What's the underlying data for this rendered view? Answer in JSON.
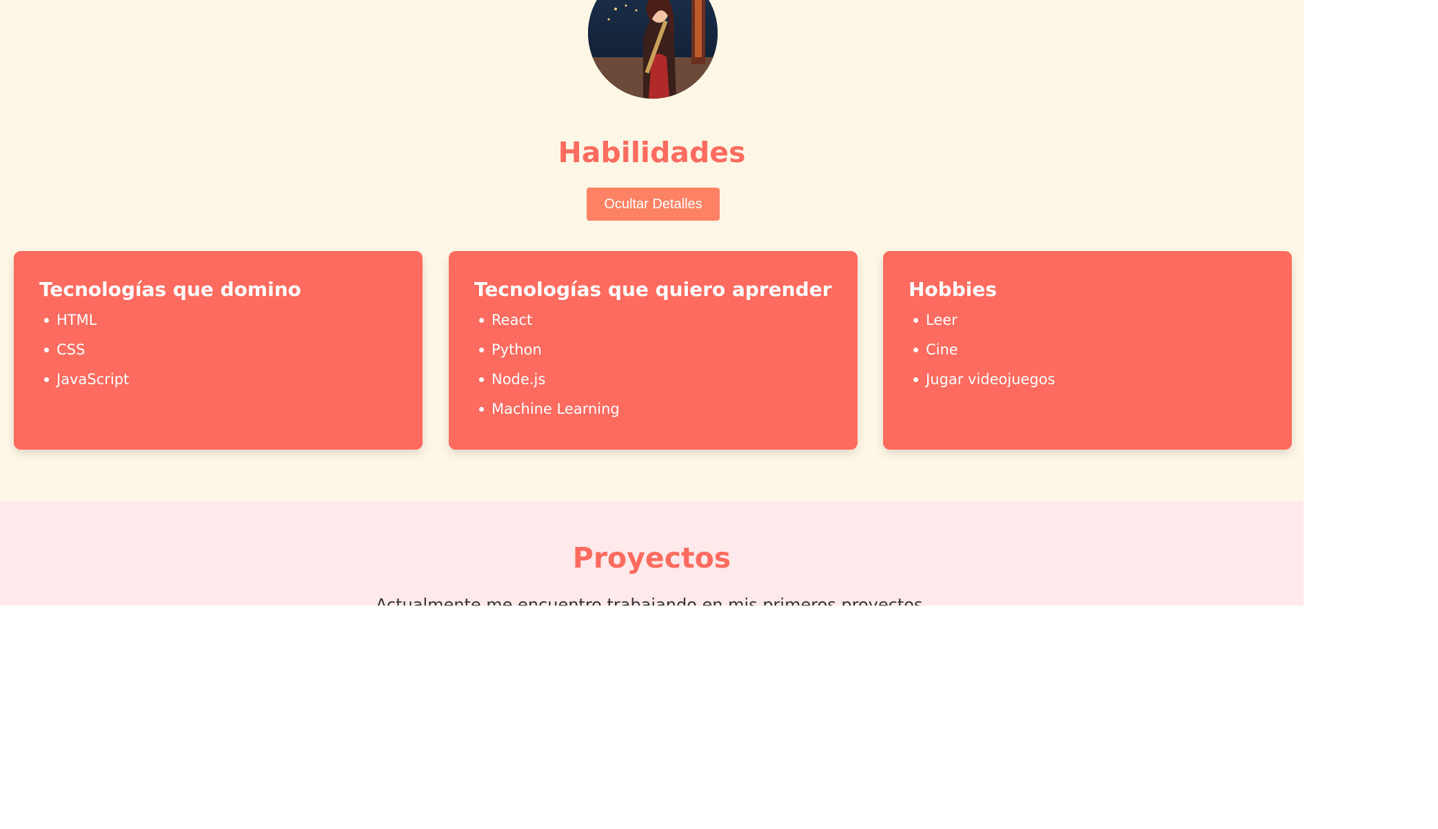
{
  "skills": {
    "title": "Habilidades",
    "toggle_label": "Ocultar Detalles",
    "cards": [
      {
        "title": "Tecnologías que domino",
        "items": [
          "HTML",
          "CSS",
          "JavaScript"
        ]
      },
      {
        "title": "Tecnologías que quiero aprender",
        "items": [
          "React",
          "Python",
          "Node.js",
          "Machine Learning"
        ]
      },
      {
        "title": "Hobbies",
        "items": [
          "Leer",
          "Cine",
          "Jugar videojuegos"
        ]
      }
    ]
  },
  "projects": {
    "title": "Proyectos",
    "text": "Actualmente me encuentro trabajando en mis primeros proyectos."
  },
  "colors": {
    "accent": "#ff6b5f",
    "button": "#ff8264",
    "skills_background": "#fff7e6",
    "projects_background": "#ffe9ea"
  }
}
